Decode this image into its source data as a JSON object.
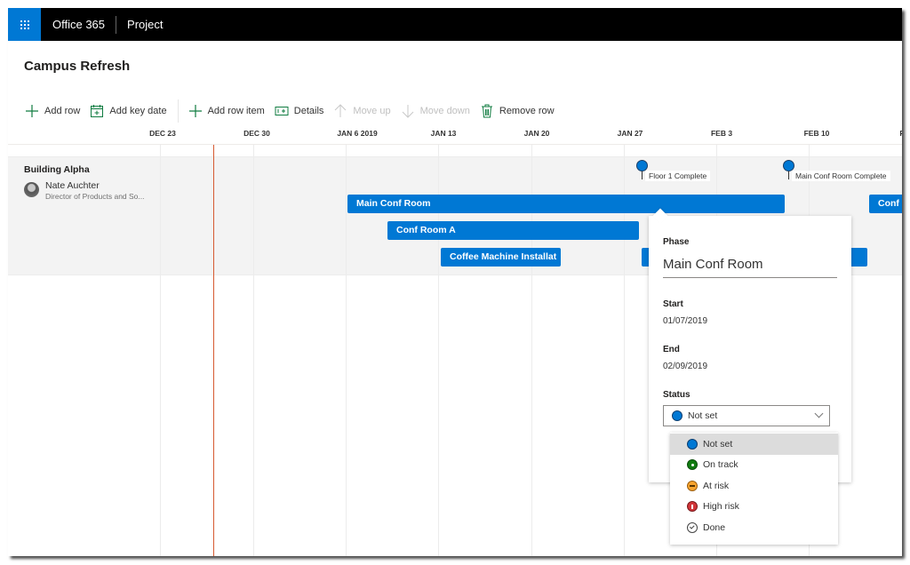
{
  "suite": {
    "brand": "Office 365",
    "app": "Project",
    "launcher_icon": "app-launcher-waffle-icon"
  },
  "page": {
    "title": "Campus Refresh"
  },
  "commands": [
    {
      "label": "Add row",
      "icon": "plus-icon",
      "enabled": true
    },
    {
      "label": "Add key date",
      "icon": "calendar-add-icon",
      "enabled": true
    },
    {
      "label": "Add row item",
      "icon": "plus-icon",
      "enabled": true
    },
    {
      "label": "Details",
      "icon": "details-panel-icon",
      "enabled": true
    },
    {
      "label": "Move up",
      "icon": "arrow-up-icon",
      "enabled": false
    },
    {
      "label": "Move down",
      "icon": "arrow-down-icon",
      "enabled": false
    },
    {
      "label": "Remove row",
      "icon": "trash-icon",
      "enabled": true
    }
  ],
  "timeline": {
    "dates": [
      "DEC 23",
      "DEC 30",
      "JAN 6 2019",
      "JAN 13",
      "JAN 20",
      "JAN 27",
      "FEB 3",
      "FEB 10",
      "F"
    ],
    "rows": [
      {
        "title": "Building Alpha",
        "owner": {
          "name": "Nate Auchter",
          "role": "Director of Products and So..."
        },
        "items": [
          {
            "label": "Main Conf Room"
          },
          {
            "label": "Conf Room A"
          },
          {
            "label": "Coffee Machine Installat"
          },
          {
            "label": ""
          },
          {
            "label": "Conf I"
          }
        ]
      }
    ],
    "key_dates": [
      {
        "label": "Floor 1 Complete"
      },
      {
        "label": "Main Conf Room Complete"
      }
    ]
  },
  "details_popover": {
    "phase_label": "Phase",
    "phase_value": "Main Conf Room",
    "start_label": "Start",
    "start_value": "01/07/2019",
    "end_label": "End",
    "end_value": "02/09/2019",
    "status_label": "Status",
    "status_value": "Not set",
    "status_options": [
      {
        "label": "Not set",
        "color": "#0078d4",
        "selected": true
      },
      {
        "label": "On track",
        "color": "#107c10",
        "selected": false
      },
      {
        "label": "At risk",
        "color": "#f7a42f",
        "selected": false
      },
      {
        "label": "High risk",
        "color": "#d13438",
        "selected": false
      },
      {
        "label": "Done",
        "color": "#ffffff",
        "selected": false
      }
    ]
  },
  "colors": {
    "accent": "#0078d4",
    "suite_bar": "#000000",
    "today_line": "#d65a31",
    "row_band": "#f3f3f3"
  }
}
